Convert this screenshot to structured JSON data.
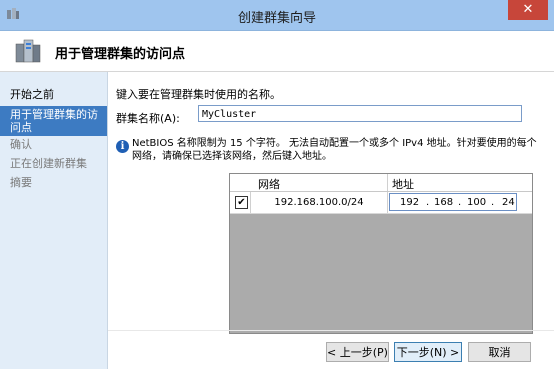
{
  "window": {
    "title": "创建群集向导",
    "close_glyph": "✕"
  },
  "header": {
    "title": "用于管理群集的访问点"
  },
  "sidebar": {
    "steps": [
      {
        "label": "开始之前",
        "state": "done"
      },
      {
        "label": "用于管理群集的访问点",
        "state": "current"
      },
      {
        "label": "确认",
        "state": "future"
      },
      {
        "label": "正在创建新群集",
        "state": "future"
      },
      {
        "label": "摘要",
        "state": "future"
      }
    ]
  },
  "main": {
    "instruction": "键入要在管理群集时使用的名称。",
    "name_label": "群集名称(A):",
    "name_value": "MyCluster",
    "info_text": "NetBIOS 名称限制为 15 个字符。 无法自动配置一个或多个 IPv4 地址。针对要使用的每个网络，请确保已选择该网络，然后键入地址。",
    "grid": {
      "col_network": "网络",
      "col_address": "地址",
      "rows": [
        {
          "checked": true,
          "check_glyph": "✔",
          "network": "192.168.100.0/24",
          "address": [
            "192",
            "168",
            "100",
            "24"
          ]
        }
      ]
    }
  },
  "buttons": {
    "prev": "< 上一步(P)",
    "next": "下一步(N) >",
    "cancel": "取消"
  },
  "colors": {
    "titlebar": "#9fc5ee",
    "sidebar": "#e2edf8",
    "selected_step": "#3d7bc2",
    "info_icon": "#1f5fb4"
  }
}
